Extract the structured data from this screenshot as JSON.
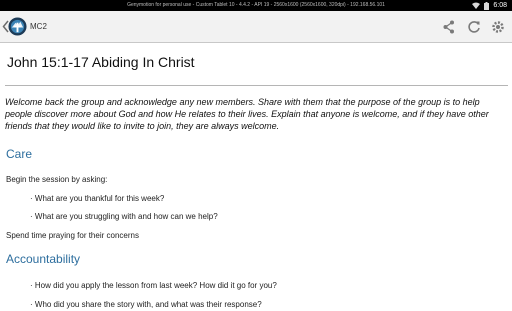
{
  "statusbar": {
    "notice": "Genymotion for personal use - Custom Tablet 10 - 4.4.2 - API 19 - 2560x1600 (2560x1600, 320dpi) - 192.168.56.101",
    "time": "6:08"
  },
  "actionbar": {
    "title": "MC2",
    "icons": [
      "share-icon",
      "refresh-icon",
      "settings-icon"
    ]
  },
  "lesson": {
    "title": "John 15:1-17 Abiding In Christ",
    "intro": "Welcome back the group and acknowledge any new members. Share with them that the purpose of the group is to help people discover more about God and how He relates to their lives. Explain that anyone is welcome, and if they have other friends that they would like to invite to join, they are always welcome.",
    "care": {
      "heading": "Care",
      "lead": "Begin the session by asking:",
      "questions": [
        "· What are you thankful for this week?",
        "· What are you struggling with and how can we help?"
      ],
      "closing": "Spend time praying for their concerns"
    },
    "accountability": {
      "heading": "Accountability",
      "questions": [
        "· How did you apply the lesson from last week? How did it go for you?",
        "· Who did you share the story with, and what was their response?"
      ]
    }
  },
  "colors": {
    "section_heading": "#2d6e9e",
    "statusbar_bg": "#000000",
    "actionbar_bg": "#f2f2f2"
  }
}
